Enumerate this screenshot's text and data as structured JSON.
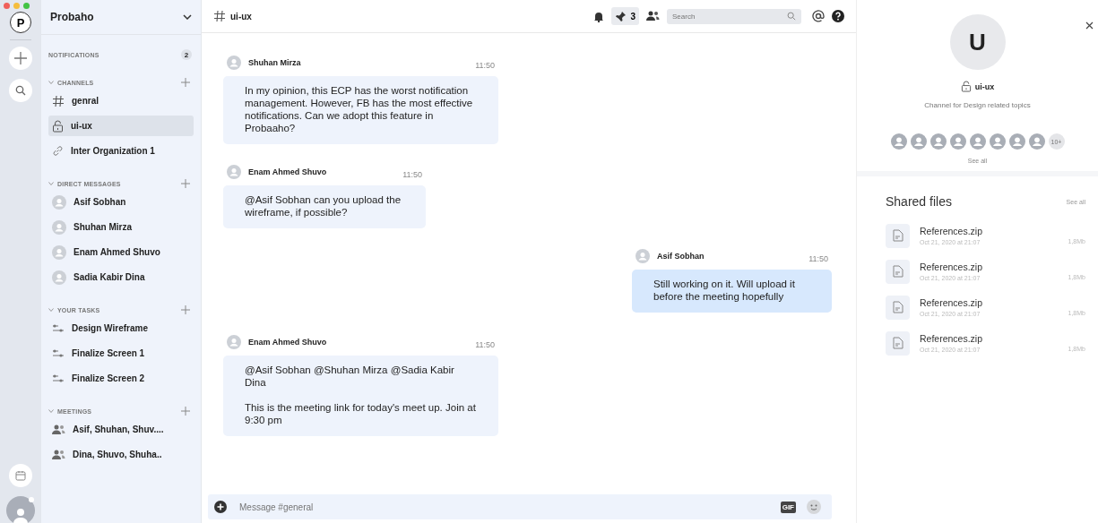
{
  "workspace": {
    "initial": "P",
    "name": "Probaho"
  },
  "notifications": {
    "label": "NOTIFICATIONS",
    "count": "2"
  },
  "sections": [
    {
      "title": "CHANNELS",
      "items": [
        {
          "kind": "hash",
          "label": "genral",
          "selected": false
        },
        {
          "kind": "lock",
          "label": "ui-ux",
          "selected": true
        },
        {
          "kind": "link",
          "label": "Inter Organization 1",
          "selected": false
        }
      ]
    },
    {
      "title": "DIRECT MESSAGES",
      "items": [
        {
          "kind": "person",
          "label": "Asif Sobhan",
          "selected": false
        },
        {
          "kind": "person",
          "label": "Shuhan Mirza",
          "selected": false
        },
        {
          "kind": "person",
          "label": "Enam Ahmed Shuvo",
          "selected": false
        },
        {
          "kind": "person",
          "label": "Sadia Kabir Dina",
          "selected": false
        }
      ]
    },
    {
      "title": "YOUR TASKS",
      "items": [
        {
          "kind": "task",
          "label": "Design Wireframe",
          "selected": false
        },
        {
          "kind": "task",
          "label": "Finalize Screen 1",
          "selected": false
        },
        {
          "kind": "task",
          "label": "Finalize Screen 2",
          "selected": false
        }
      ]
    },
    {
      "title": "MEETINGS",
      "items": [
        {
          "kind": "group",
          "label": "Asif, Shuhan, Shuv....",
          "selected": false
        },
        {
          "kind": "group",
          "label": "Dina, Shuvo, Shuha..",
          "selected": false
        }
      ]
    }
  ],
  "header": {
    "channel": "ui-ux",
    "pinned_count": "3",
    "search_placeholder": "Search"
  },
  "messages": [
    {
      "author": "Shuhan Mirza",
      "time": "11:50",
      "own": false,
      "paragraphs": [
        "In my opinion, this ECP has the worst notification management. However, FB has the most effective notifications. Can we adopt this feature in Probaaho?"
      ]
    },
    {
      "author": "Enam Ahmed Shuvo",
      "time": "11:50",
      "own": false,
      "paragraphs": [
        "@Asif Sobhan can you upload the wireframe, if possible?"
      ]
    },
    {
      "author": "Asif Sobhan",
      "time": "11:50",
      "own": true,
      "paragraphs": [
        "Still working on it. Will upload it before the meeting hopefully"
      ]
    },
    {
      "author": "Enam Ahmed Shuvo",
      "time": "11:50",
      "own": false,
      "paragraphs": [
        "@Asif Sobhan @Shuhan Mirza @Sadia Kabir Dina",
        "This is the meeting link for today's meet up. Join at 9:30 pm"
      ]
    }
  ],
  "composer": {
    "placeholder": "Message #general",
    "gif_label": "GIF"
  },
  "details": {
    "initial": "U",
    "channel": "ui-ux",
    "description": "Channel for Design related topics",
    "member_more": "10+",
    "see_all": "See all"
  },
  "shared_files": {
    "title": "Shared files",
    "see_all": "See all",
    "files": [
      {
        "name": "References.zip",
        "date": "Oct 21, 2020 at 21:07",
        "size": "1,8Mb"
      },
      {
        "name": "References.zip",
        "date": "Oct 21, 2020 at 21:07",
        "size": "1,8Mb"
      },
      {
        "name": "References.zip",
        "date": "Oct 21, 2020 at 21:07",
        "size": "1,8Mb"
      },
      {
        "name": "References.zip",
        "date": "Oct 21, 2020 at 21:07",
        "size": "1,8Mb"
      }
    ]
  }
}
